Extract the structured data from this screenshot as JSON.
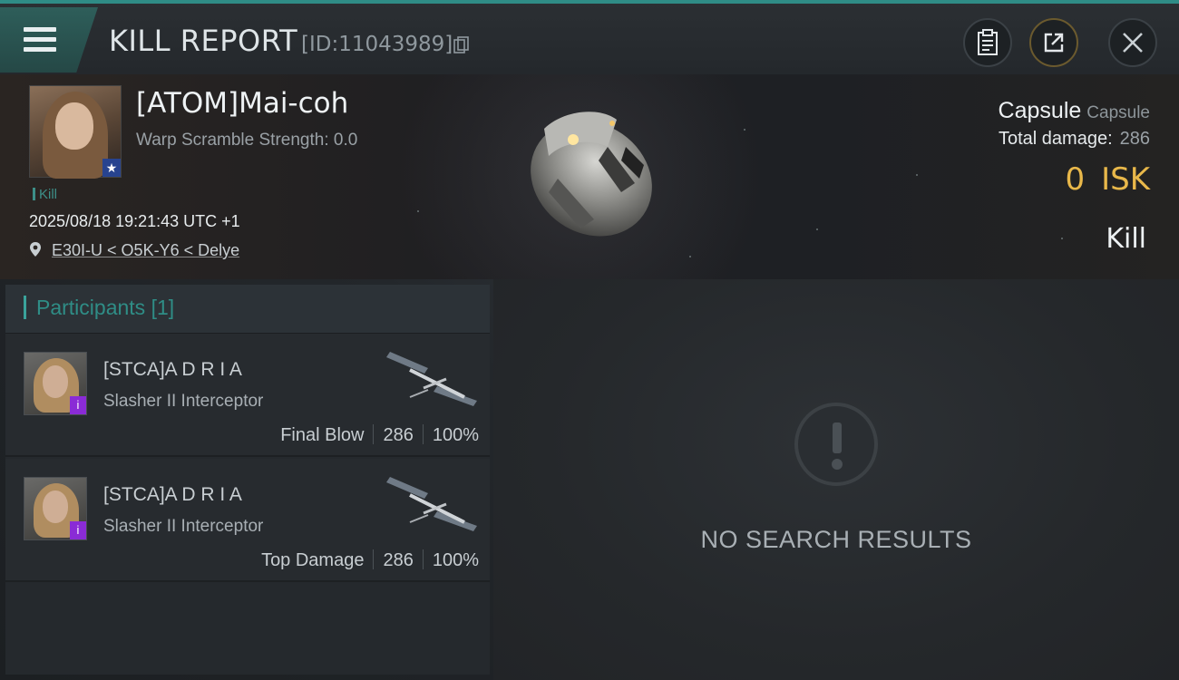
{
  "header": {
    "title": "KILL REPORT",
    "report_id": "[ID:11043989]",
    "icons": [
      "menu-icon",
      "copy-icon",
      "clipboard-icon",
      "share-icon",
      "close-icon"
    ]
  },
  "victim": {
    "name": "[ATOM]Mai-coh",
    "warp_scramble": "Warp Scramble Strength: 0.0",
    "kill_tag": "Kill",
    "timestamp": "2025/08/18 19:21:43 UTC +1",
    "location": "E30I-U < O5K-Y6 < Delye",
    "ship_name": "Capsule",
    "ship_class": "Capsule",
    "total_damage_label": "Total damage:",
    "total_damage": "286",
    "isk_value": "0",
    "isk_unit": "ISK",
    "result": "Kill"
  },
  "participants": {
    "label": "Participants",
    "count": "[1]",
    "rows": [
      {
        "name": "[STCA]A D R I A",
        "ship": "Slasher II Interceptor",
        "role": "Final Blow",
        "damage": "286",
        "percent": "100%"
      },
      {
        "name": "[STCA]A D R I A",
        "ship": "Slasher II Interceptor",
        "role": "Top Damage",
        "damage": "286",
        "percent": "100%"
      }
    ]
  },
  "results_panel": {
    "message": "NO SEARCH RESULTS"
  },
  "colors": {
    "accent": "#2f8c86",
    "isk": "#e9b84a",
    "badge_purple": "#8a2bd6",
    "badge_blue": "#27438f"
  }
}
